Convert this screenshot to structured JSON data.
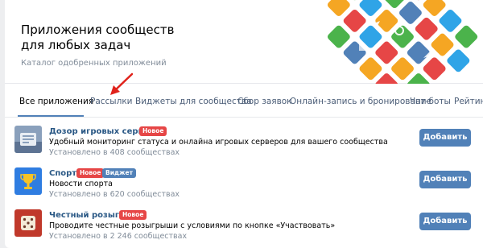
{
  "header": {
    "title_line1": "Приложения сообществ",
    "title_line2": "для любых задач",
    "subtitle": "Каталог одобренных приложений"
  },
  "tabs": [
    {
      "label": "Все приложения",
      "active": true
    },
    {
      "label": "Рассылки",
      "active": false
    },
    {
      "label": "Виджеты для сообщества",
      "active": false
    },
    {
      "label": "Сбор заявок",
      "active": false
    },
    {
      "label": "Онлайн-запись и бронирование",
      "active": false
    },
    {
      "label": "Чат-боты",
      "active": false
    },
    {
      "label": "Рейтин",
      "active": false
    }
  ],
  "apps": [
    {
      "name": "Дозор игровых серверов",
      "badges": [
        "Новое"
      ],
      "description": "Удобный мониторинг статуса и онлайна игровых серверов для вашего сообщества",
      "installs": "Установлено в 408 сообществах",
      "button": "Добавить",
      "icon": "server-icon"
    },
    {
      "name": "Спорт",
      "badges": [
        "Новое",
        "Виджет"
      ],
      "description": "Новости спорта",
      "installs": "Установлено в 620 сообществах",
      "button": "Добавить",
      "icon": "trophy-icon"
    },
    {
      "name": "Честный розыгрыш",
      "badges": [
        "Новое"
      ],
      "description": "Проводите честные розыгрыши с условиями по кнопке «Участвовать»",
      "installs": "Установлено в 2 246 сообществах",
      "button": "Добавить",
      "icon": "dice-icon"
    }
  ],
  "colors": {
    "accent": "#5181b8",
    "link": "#2a5885",
    "badge_new": "#e64646",
    "muted": "#818c99",
    "arrow": "#e0221b"
  }
}
